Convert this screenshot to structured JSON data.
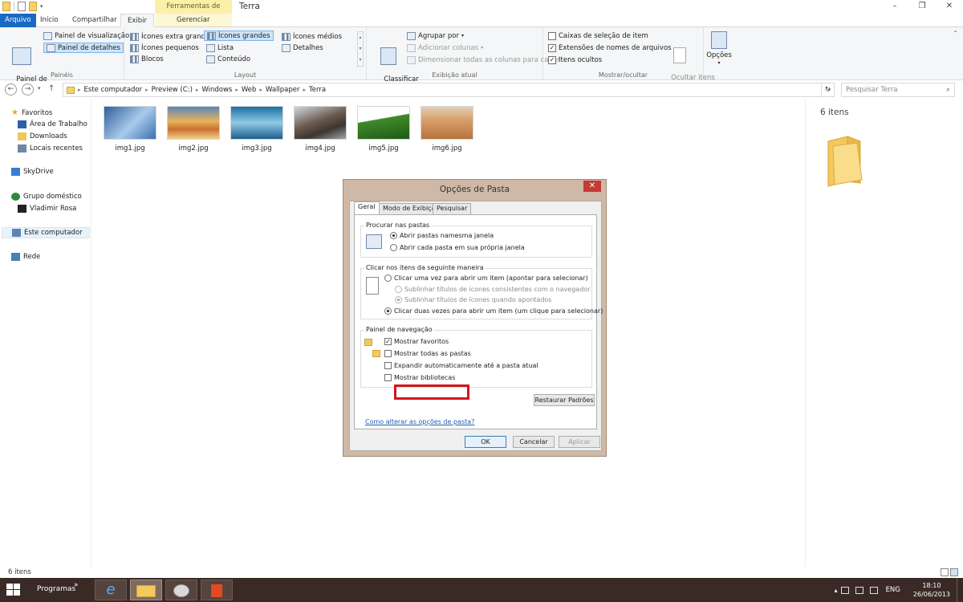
{
  "window": {
    "title": "Terra",
    "context_tab": "Ferramentas de Imagem",
    "controls": [
      "–",
      "❐",
      "✕"
    ]
  },
  "tabs": [
    {
      "label": "Arquivo"
    },
    {
      "label": "Início"
    },
    {
      "label": "Compartilhar"
    },
    {
      "label": "Exibir"
    },
    {
      "label": "Gerenciar"
    }
  ],
  "ribbon": {
    "paineis": {
      "label": "Painéis",
      "nav_pane": "Painel de\nnavegação",
      "preview": "Painel de visualização",
      "details": "Painel de detalhes"
    },
    "layout": {
      "label": "Layout",
      "items": [
        "Ícones extra grandes",
        "Ícones grandes",
        "Ícones médios",
        "Ícones pequenos",
        "Lista",
        "Detalhes",
        "Blocos",
        "Conteúdo"
      ]
    },
    "exibicao": {
      "label": "Exibição atual",
      "sort": "Classificar\npor",
      "group_by": "Agrupar por",
      "add_cols": "Adicionar colunas",
      "size_cols": "Dimensionar todas as colunas para caber"
    },
    "mostrar": {
      "label": "Mostrar/ocultar",
      "checkboxes": "Caixas de seleção de item",
      "extensions": "Extensões de nomes de arquivos",
      "hidden": "Itens ocultos",
      "hide_selected": "Ocultar itens\nselecionados"
    },
    "opcoes": "Opções"
  },
  "address": {
    "crumbs": [
      "Este computador",
      "Preview (C:)",
      "Windows",
      "Web",
      "Wallpaper",
      "Terra"
    ],
    "search_placeholder": "Pesquisar Terra"
  },
  "nav": {
    "favoritos": "Favoritos",
    "area_trabalho": "Área de Trabalho",
    "downloads": "Downloads",
    "locais": "Locais recentes",
    "skydrive": "SkyDrive",
    "grupo": "Grupo doméstico",
    "user": "Vladimir Rosa",
    "computador": "Este computador",
    "rede": "Rede"
  },
  "files": [
    {
      "name": "img1.jpg",
      "color": "#5e8fc4"
    },
    {
      "name": "img2.jpg",
      "color": "#d9a34a"
    },
    {
      "name": "img3.jpg",
      "color": "#2f8fbf"
    },
    {
      "name": "img4.jpg",
      "color": "#7b6f66"
    },
    {
      "name": "img5.jpg",
      "color": "#3f8a2a"
    },
    {
      "name": "img6.jpg",
      "color": "#c89563"
    }
  ],
  "details": {
    "count": "6 itens"
  },
  "status": {
    "count": "6 itens"
  },
  "dialog": {
    "title": "Opções de Pasta",
    "tabs": [
      "Geral",
      "Modo de Exibição",
      "Pesquisar"
    ],
    "procurar": {
      "legend": "Procurar nas pastas",
      "opt1": "Abrir pastas namesma janela",
      "opt2": "Abrir cada pasta em sua própria janela"
    },
    "clicar": {
      "legend": "Clicar nos itens da seguinte maneira",
      "opt1": "Clicar uma vez para abrir um item (apontar para selecionar)",
      "sub1": "Sublinhar títulos de ícones consistentes com o navegador",
      "sub2": "Sublinhar títulos de ícones quando apontados",
      "opt2": "Clicar duas vezes para abrir um item (um clique para selecionar)"
    },
    "painel": {
      "legend": "Painel de navegação",
      "c1": "Mostrar favoritos",
      "c2": "Mostrar todas as pastas",
      "c3": "Expandir automaticamente até a pasta atual",
      "c4": "Mostrar bibliotecas"
    },
    "restore": "Restaurar Padrões",
    "link": "Como alterar as opções de pasta?",
    "ok": "OK",
    "cancel": "Cancelar",
    "apply": "Aplicar"
  },
  "taskbar": {
    "programs": "Programas",
    "chevron": "»",
    "lang": "ENG",
    "time": "18:10",
    "date": "26/06/2013"
  }
}
